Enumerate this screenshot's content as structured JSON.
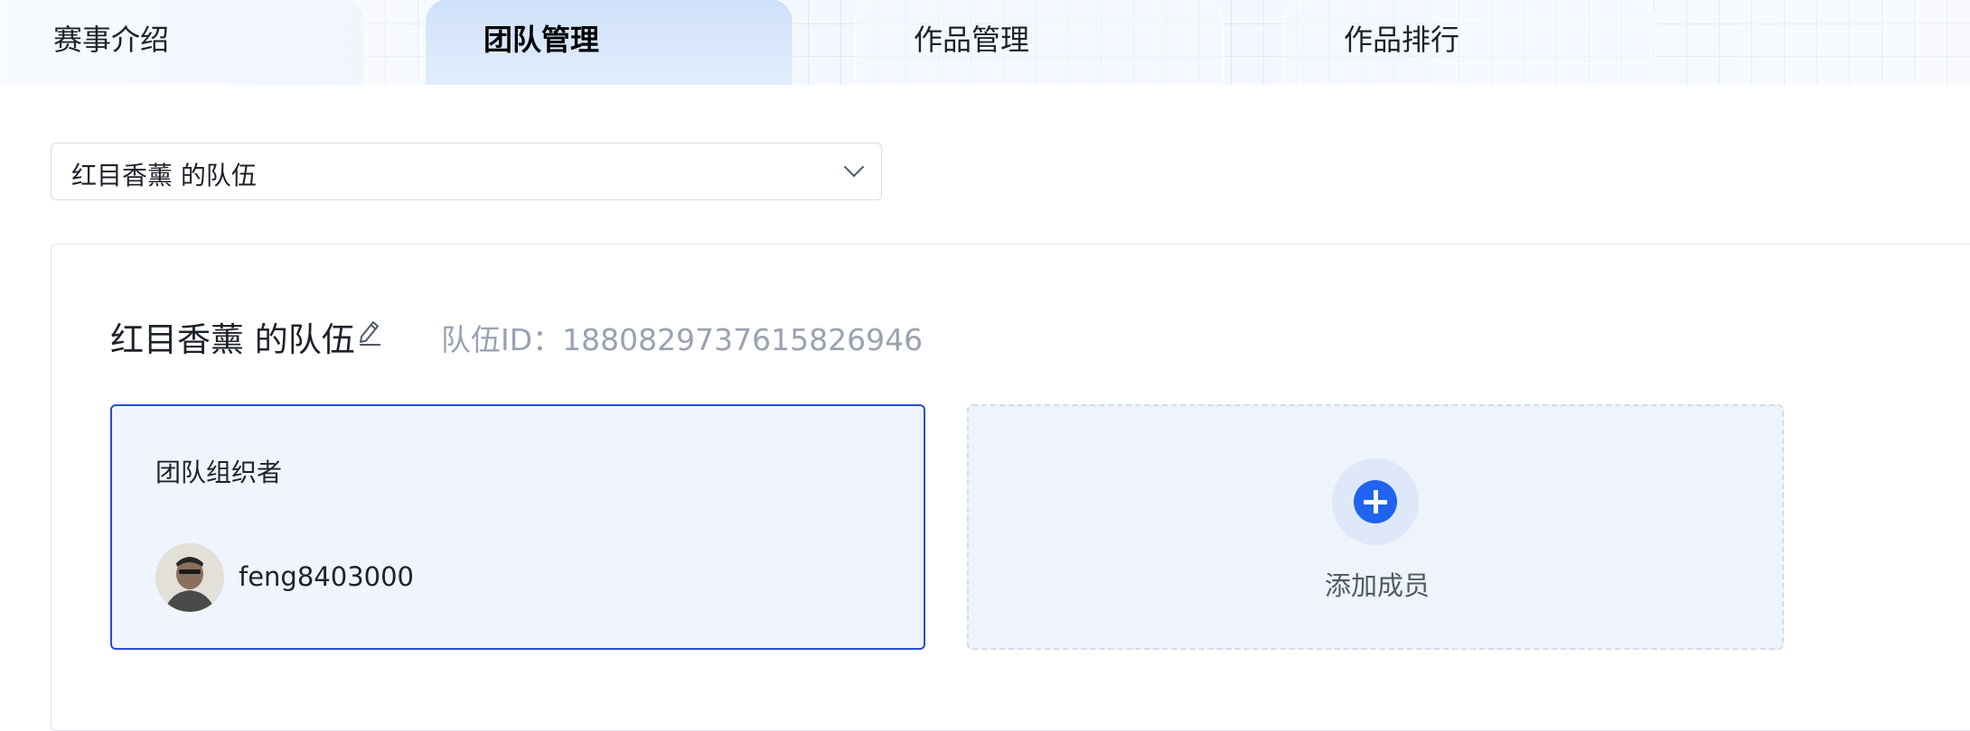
{
  "tabs": [
    {
      "label": "赛事介绍"
    },
    {
      "label": "团队管理",
      "active": true
    },
    {
      "label": "作品管理"
    },
    {
      "label": "作品排行"
    }
  ],
  "team_select": {
    "value": "红目香薰 的队伍"
  },
  "team": {
    "name": "红目香薰 的队伍",
    "id_label": "队伍ID：",
    "id_value": "1880829737615826946"
  },
  "members": [
    {
      "role": "团队组织者",
      "username": "feng8403000"
    }
  ],
  "add_member": {
    "label": "添加成员"
  },
  "icons": [
    "edit-icon",
    "chevron-down-icon",
    "plus-icon",
    "avatar"
  ],
  "colors": {
    "accent": "#1f63f0",
    "card_border": "#2b4cd6",
    "card_bg": "#eff4ff",
    "muted": "#9aa2b1"
  }
}
